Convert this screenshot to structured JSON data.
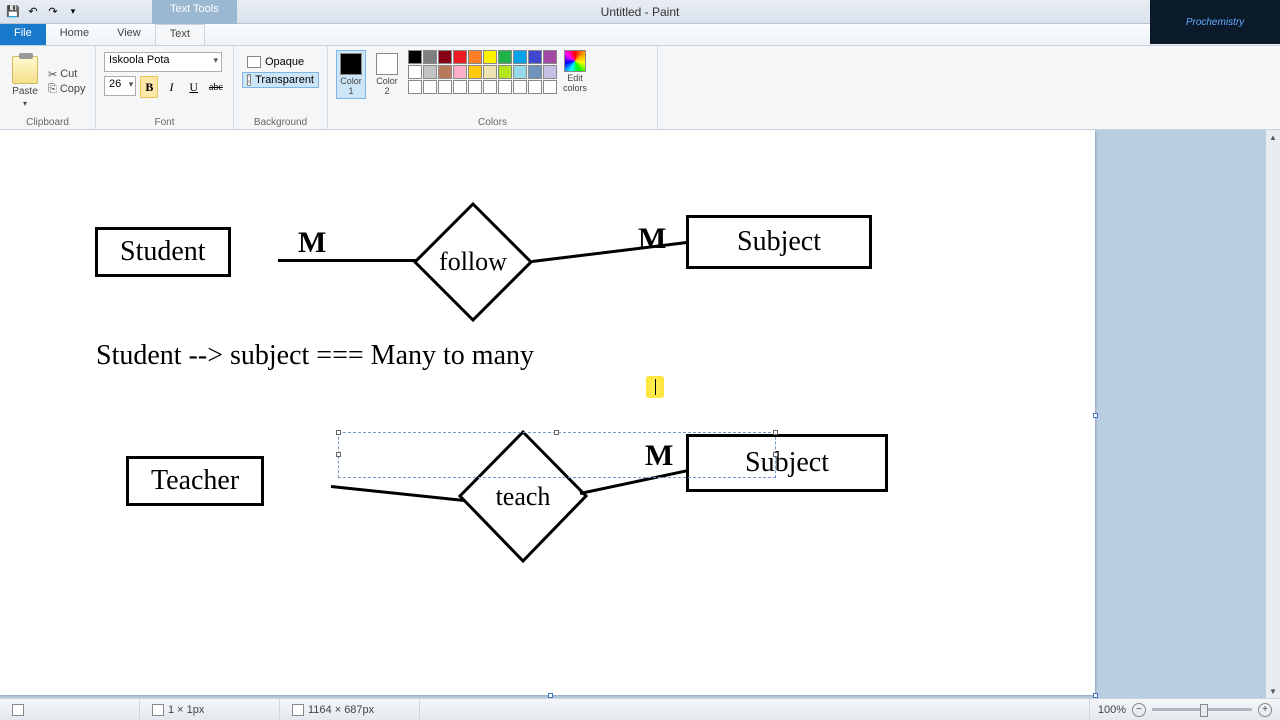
{
  "window": {
    "title": "Untitled - Paint",
    "context_tab": "Text Tools"
  },
  "tabs": {
    "file": "File",
    "home": "Home",
    "view": "View",
    "text": "Text"
  },
  "clipboard": {
    "paste": "Paste",
    "cut": "Cut",
    "copy": "Copy",
    "group": "Clipboard"
  },
  "font": {
    "family": "Iskoola Pota",
    "size": "26",
    "group": "Font"
  },
  "background": {
    "opaque": "Opaque",
    "transparent": "Transparent",
    "group": "Background"
  },
  "colors": {
    "color1": "Color\n1",
    "color2": "Color\n2",
    "edit": "Edit\ncolors",
    "group": "Colors",
    "c1_value": "#000000",
    "c2_value": "#ffffff",
    "row1": [
      "#000000",
      "#7f7f7f",
      "#880015",
      "#ed1c24",
      "#ff7f27",
      "#fff200",
      "#22b14c",
      "#00a2e8",
      "#3f48cc",
      "#a349a4"
    ],
    "row2": [
      "#ffffff",
      "#c3c3c3",
      "#b97a57",
      "#ffaec9",
      "#ffc90e",
      "#efe4b0",
      "#b5e61d",
      "#99d9ea",
      "#7092be",
      "#c8bfe7"
    ]
  },
  "er": {
    "student": "Student",
    "subject1": "Subject",
    "follow": "follow",
    "teacher": "Teacher",
    "subject2": "Subject",
    "teach": "teach",
    "m1": "M",
    "m2": "M",
    "m3": "M",
    "text": "Student --> subject === Many to many"
  },
  "status": {
    "cursor": "1 × 1px",
    "size": "1164 × 687px",
    "zoom": "100%"
  }
}
